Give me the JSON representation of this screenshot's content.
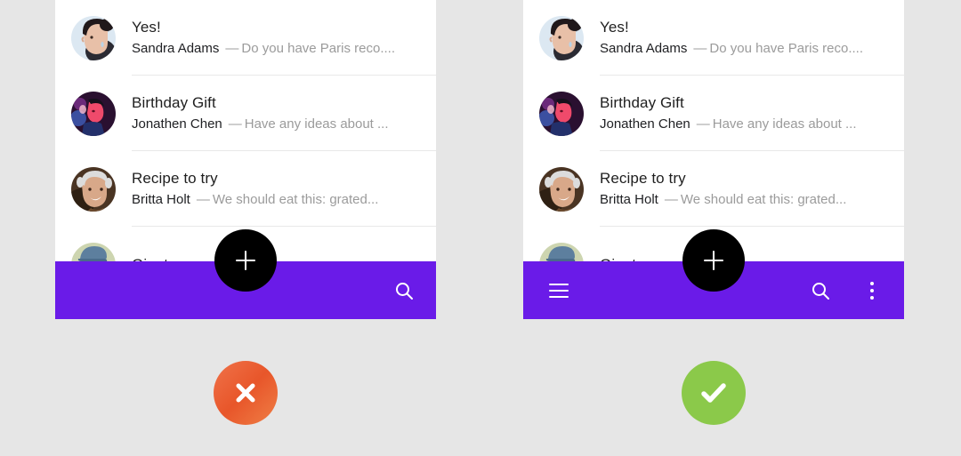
{
  "colors": {
    "background": "#e6e6e6",
    "panel": "#ffffff",
    "app_bar_purple": "#6A1BE8",
    "fab": "#000000",
    "badge_incorrect": "#e8562a",
    "badge_correct": "#8bc94a",
    "divider": "#e8e8e8",
    "subject_text": "#1f1f1f",
    "snippet_text": "#9b9b9b"
  },
  "messages": [
    {
      "subject": "Yes!",
      "sender": "Sandra Adams",
      "separator": "—",
      "snippet": "Do you have Paris reco....",
      "avatar": "woman-dark-hair-avatar"
    },
    {
      "subject": "Birthday Gift",
      "sender": "Jonathen Chen",
      "separator": "—",
      "snippet": "Have any ideas about ...",
      "avatar": "man-pink-light-avatar"
    },
    {
      "subject": "Recipe to try",
      "sender": "Britta Holt",
      "separator": "—",
      "snippet": "We should eat this: grated...",
      "avatar": "woman-gray-hair-avatar"
    },
    {
      "subject": "Giants gam",
      "sender": "",
      "separator": "",
      "snippet": "",
      "avatar": "man-blue-cap-avatar"
    }
  ],
  "left_panel": {
    "name": "incorrect-example",
    "bottom_bar": {
      "has_menu": false,
      "icons": [
        "search-icon"
      ],
      "search_label": "Search"
    },
    "fab": {
      "icon": "plus-icon",
      "label": "Compose"
    },
    "verdict": {
      "icon": "close-icon",
      "label": "Incorrect"
    }
  },
  "right_panel": {
    "name": "correct-example",
    "bottom_bar": {
      "has_menu": true,
      "icons": [
        "menu-icon",
        "search-icon",
        "more-vert-icon"
      ],
      "menu_label": "Navigation menu",
      "search_label": "Search",
      "overflow_label": "More options"
    },
    "fab": {
      "icon": "plus-icon",
      "label": "Compose"
    },
    "verdict": {
      "icon": "check-icon",
      "label": "Correct"
    }
  }
}
